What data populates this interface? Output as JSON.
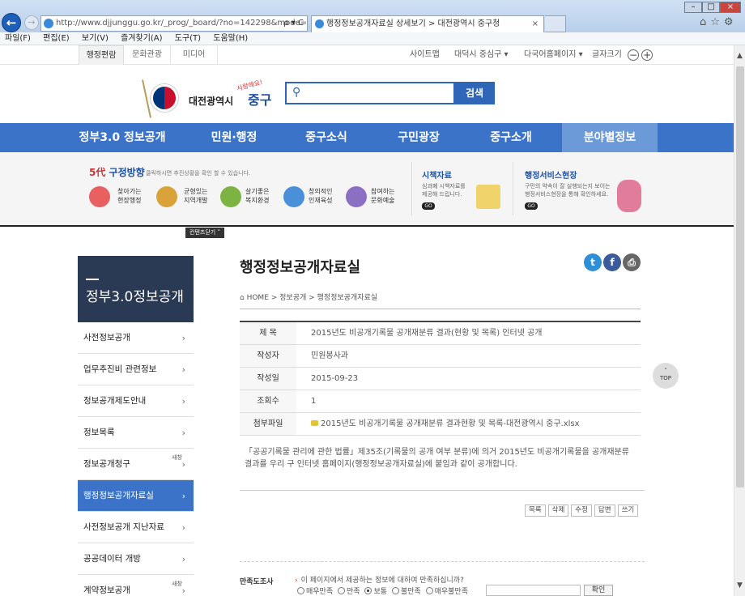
{
  "browser": {
    "url": "http://www.djjunggu.go.kr/_prog/_board/?no=142298&mode=V&cod",
    "url_controls": "ρ ▾ C",
    "tab_title": "행정정보공개자료실 상세보기 > 대전광역시 중구청",
    "tab_close": "×",
    "back": "←",
    "forward": "→",
    "win_min": "–",
    "win_max": "□",
    "win_close": "×",
    "right_tools": "⌂☆⚙",
    "menu": [
      "파일(F)",
      "편집(E)",
      "보기(V)",
      "즐겨찾기(A)",
      "도구(T)",
      "도움말(H)"
    ],
    "scroll_up": "▲",
    "scroll_down": "▼"
  },
  "util": {
    "tabs": [
      "행정편람",
      "문화관광",
      "미디어"
    ],
    "sitemap": "사이트맵",
    "district": "대덕시 중심구  ▾",
    "lang": "다국어홈페이지 ▾",
    "fontsize": "글자크기",
    "minus": "−",
    "plus": "+"
  },
  "header": {
    "logo_city": "대전광역시",
    "logo_gu": "중구",
    "logo_slogan": "사랑해요!",
    "search_placeholder": "",
    "search_button": "검색",
    "search_icon": "search-icon"
  },
  "gnb": [
    "정부3.0 정보공개",
    "민원·행정",
    "중구소식",
    "구민광장",
    "중구소개",
    "분야별정보"
  ],
  "promo": {
    "title_num": "5代",
    "title": " 구정방향",
    "subtitle": "클릭하시면 추진상황을 확인 할 수 있습니다.",
    "items": [
      "찾아가는\n현장행정",
      "균형있는\n지역개발",
      "살기좋은\n복지환경",
      "창의적인\n인재육성",
      "참여하는\n문화예술"
    ],
    "sec1_title": "시책자료",
    "sec1_desc": "심과폐 시책자료를\n제공해 드립니다.",
    "sec2_title": "행정서비스현장",
    "sec2_desc": "구민의 약속이 잘 실행되는지 보이는\n행정서비스현장을 통해 확인하세요.",
    "go": "GO"
  },
  "quick": "컨텐츠닫기 ˄",
  "lnb": {
    "title": "정부3.0정보공개",
    "arrow": "›",
    "new": "새창",
    "items": [
      "사전정보공개",
      "업무추진비 관련정보",
      "정보공개제도안내",
      "정보목록",
      "정보공개청구",
      "행정정보공개자료실",
      "사전정보공개 지난자료",
      "공공데이터 개방",
      "계약정보공개"
    ]
  },
  "content": {
    "title": "행정정보공개자료실",
    "breadcrumb": "⌂ HOME > 정보공개 > 행정정보공개자료실",
    "sns": [
      "t",
      "f",
      "⎙"
    ],
    "rows": [
      {
        "label": "제  목",
        "value": "2015년도 비공개기록물 공개재분류 결과(현황 및 목록) 인터넷 공개"
      },
      {
        "label": "작성자",
        "value": "민원봉사과"
      },
      {
        "label": "작성일",
        "value": "2015-09-23"
      },
      {
        "label": "조회수",
        "value": "1"
      },
      {
        "label": "첨부파일",
        "value": "2015년도 비공개기록물 공개재분류 결과현황 및 목록-대전광역시 중구.xlsx"
      }
    ],
    "body": "「공공기록물 관리에 관한 법률」제35조(기록물의 공개 여부 분류)에 의거 2015년도 비공개기록물을 공개재분류 결과를 우리 구 인터넷 홈페이지(행정정보공개자료실)에 붙임과 같이 공개합니다.",
    "buttons": [
      "목록",
      "삭제",
      "수정",
      "답변",
      "쓰기"
    ]
  },
  "survey": {
    "label": "만족도조사",
    "question": "이 페이지에서 제공하는 정보에 대하여 만족하십니까?",
    "chev": "›",
    "options": [
      "매우만족",
      "만족",
      "보통",
      "불만족",
      "매우불만족"
    ],
    "selected": "보통",
    "confirm": "확인"
  },
  "top_button": "TOP",
  "top_arrow": "˄"
}
